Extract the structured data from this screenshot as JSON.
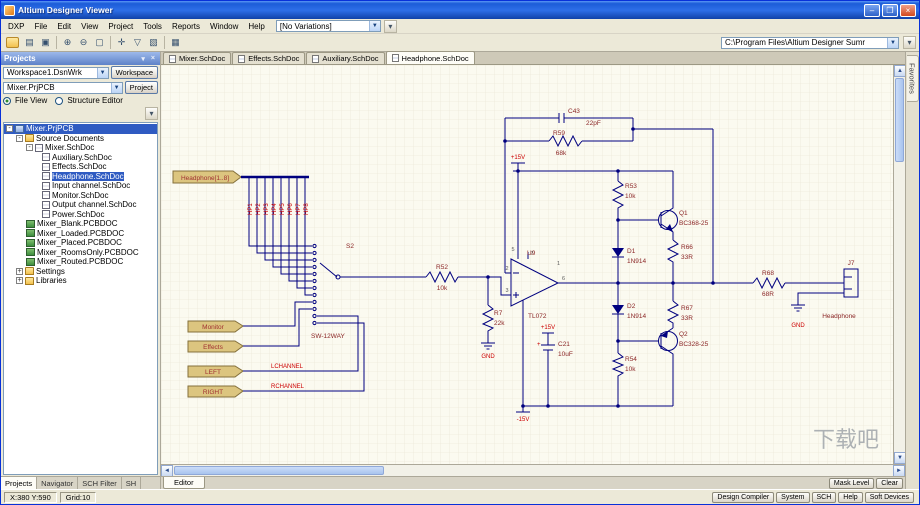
{
  "window": {
    "title": "Altium Designer Viewer",
    "buttons": {
      "minimize": "–",
      "maximize": "❒",
      "close": "×"
    }
  },
  "menubar": {
    "items": [
      "DXP",
      "File",
      "Edit",
      "View",
      "Project",
      "Tools",
      "Reports",
      "Window",
      "Help"
    ],
    "variations": "[No Variations]"
  },
  "toolbar": {
    "address": "C:\\Program Files\\Altium Designer Sumr"
  },
  "projects_panel": {
    "title": "Projects",
    "workspace_combo": "Workspace1.DsnWrk",
    "workspace_button": "Workspace",
    "project_combo": "Mixer.PrjPCB",
    "project_button": "Project",
    "file_view": "File View",
    "structure_editor": "Structure Editor",
    "tree": [
      {
        "label": "Mixer.PrjPCB"
      },
      {
        "label": "Source Documents"
      },
      {
        "label": "Mixer.SchDoc"
      },
      {
        "label": "Auxiliary.SchDoc"
      },
      {
        "label": "Effects.SchDoc"
      },
      {
        "label": "Headphone.SchDoc"
      },
      {
        "label": "Input channel.SchDoc"
      },
      {
        "label": "Monitor.SchDoc"
      },
      {
        "label": "Output channel.SchDoc"
      },
      {
        "label": "Power.SchDoc"
      },
      {
        "label": "Mixer_Blank.PCBDOC"
      },
      {
        "label": "Mixer_Loaded.PCBDOC"
      },
      {
        "label": "Mixer_Placed.PCBDOC"
      },
      {
        "label": "Mixer_RoomsOnly.PCBDOC"
      },
      {
        "label": "Mixer_Routed.PCBDOC"
      },
      {
        "label": "Settings"
      },
      {
        "label": "Libraries"
      }
    ],
    "bottom_tabs": [
      "Projects",
      "Navigator",
      "SCH Filter",
      "SH"
    ]
  },
  "doc_tabs": [
    "Mixer.SchDoc",
    "Effects.SchDoc",
    "Auxiliary.SchDoc",
    "Headphone.SchDoc"
  ],
  "editor_tab": "Editor",
  "mask_level_button": "Mask Level",
  "clear_button": "Clear",
  "favorites_tab": "Favorites",
  "statusbar": {
    "coords": "X:380 Y:590",
    "grid": "Grid:10",
    "panels": [
      "Design Compiler",
      "System",
      "SCH",
      "Help",
      "Soft Devices"
    ]
  },
  "watermark": "下载吧",
  "schematic": {
    "port_headphone": "Headphone[1..8]",
    "hp_labels": [
      "HP1",
      "HP2",
      "HP3",
      "HP4",
      "HP5",
      "HP6",
      "HP7",
      "HP8"
    ],
    "switch": {
      "ref": "S2",
      "part": "SW-12WAY"
    },
    "r52": {
      "ref": "R52",
      "val": "10k"
    },
    "r7": {
      "ref": "R7",
      "val": "22k"
    },
    "r53": {
      "ref": "R53",
      "val": "10k"
    },
    "r54": {
      "ref": "R54",
      "val": "10k"
    },
    "r59": {
      "ref": "R59",
      "val": "68k"
    },
    "r66": {
      "ref": "R66",
      "val": "33R"
    },
    "r67": {
      "ref": "R67",
      "val": "33R"
    },
    "r68": {
      "ref": "R68",
      "val": "68R"
    },
    "c43": {
      "ref": "C43",
      "val": "22pF"
    },
    "c21": {
      "ref": "C21",
      "val": "10uF",
      "plus": "+"
    },
    "u9": {
      "ref": "U9",
      "part": "TL072",
      "pin1": "1",
      "pin2": "2",
      "pin3": "3",
      "pin5": "5",
      "pin6": "6",
      "pin7": "7"
    },
    "q1": {
      "ref": "Q1",
      "part": "BC368-25"
    },
    "q2": {
      "ref": "Q2",
      "part": "BC328-25"
    },
    "d1": {
      "ref": "D1",
      "part": "1N914"
    },
    "d2": {
      "ref": "D2",
      "part": "1N914"
    },
    "j7": {
      "ref": "J7",
      "label": "Headphone"
    },
    "ports": {
      "monitor": "Monitor",
      "effects": "Effects",
      "left": "LEFT",
      "right": "RIGHT"
    },
    "nets": {
      "lchannel": "LCHANNEL",
      "rchannel": "RCHANNEL"
    },
    "power": {
      "p15": "+15V",
      "n15": "-15V",
      "gnd": "GND"
    }
  }
}
